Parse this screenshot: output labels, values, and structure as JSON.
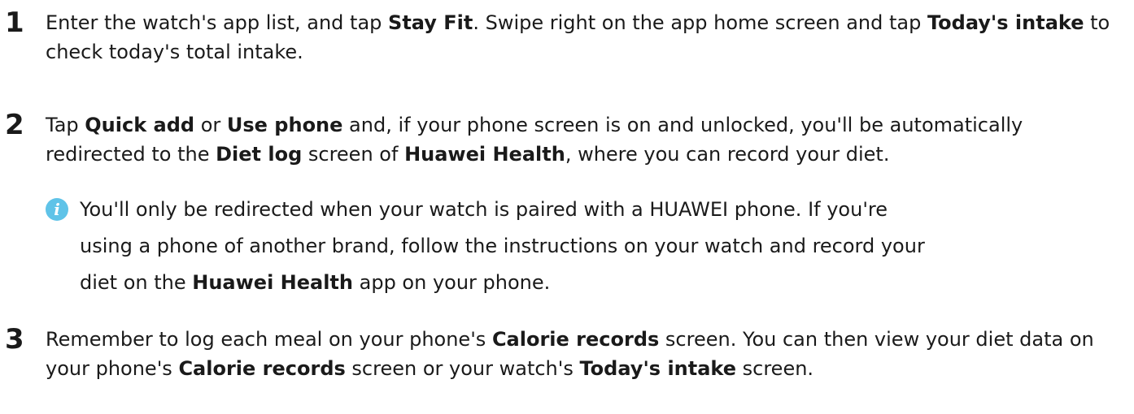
{
  "steps": [
    {
      "number": "1",
      "segments": [
        {
          "text": "Enter the watch's app list, and tap ",
          "bold": false
        },
        {
          "text": "Stay Fit",
          "bold": true
        },
        {
          "text": ". Swipe right on the app home screen and tap ",
          "bold": false
        },
        {
          "text": "Today's intake",
          "bold": true
        },
        {
          "text": " to check today's total intake.",
          "bold": false
        }
      ]
    },
    {
      "number": "2",
      "segments": [
        {
          "text": "Tap ",
          "bold": false
        },
        {
          "text": "Quick add",
          "bold": true
        },
        {
          "text": " or ",
          "bold": false
        },
        {
          "text": "Use phone",
          "bold": true
        },
        {
          "text": " and, if your phone screen is on and unlocked, you'll be automatically redirected to the ",
          "bold": false
        },
        {
          "text": "Diet log",
          "bold": true
        },
        {
          "text": " screen of ",
          "bold": false
        },
        {
          "text": "Huawei Health",
          "bold": true
        },
        {
          "text": ", where you can record your diet.",
          "bold": false
        }
      ]
    },
    {
      "number": "3",
      "segments": [
        {
          "text": "Remember to log each meal on your phone's ",
          "bold": false
        },
        {
          "text": "Calorie records",
          "bold": true
        },
        {
          "text": " screen. You can then view your diet data on your phone's ",
          "bold": false
        },
        {
          "text": "Calorie records",
          "bold": true
        },
        {
          "text": " screen or your watch's ",
          "bold": false
        },
        {
          "text": "Today's intake",
          "bold": true
        },
        {
          "text": " screen.",
          "bold": false
        }
      ]
    }
  ],
  "note": {
    "icon": "info-icon",
    "icon_glyph": "i",
    "icon_color": "#5fc3e8",
    "line1": "You'll only be redirected when your watch is paired with a HUAWEI phone. If you're",
    "line2": "using a phone of another brand, follow the instructions on your watch and record your",
    "line3_pre": "diet on the ",
    "line3_bold": "Huawei Health",
    "line3_post": " app on your phone."
  }
}
